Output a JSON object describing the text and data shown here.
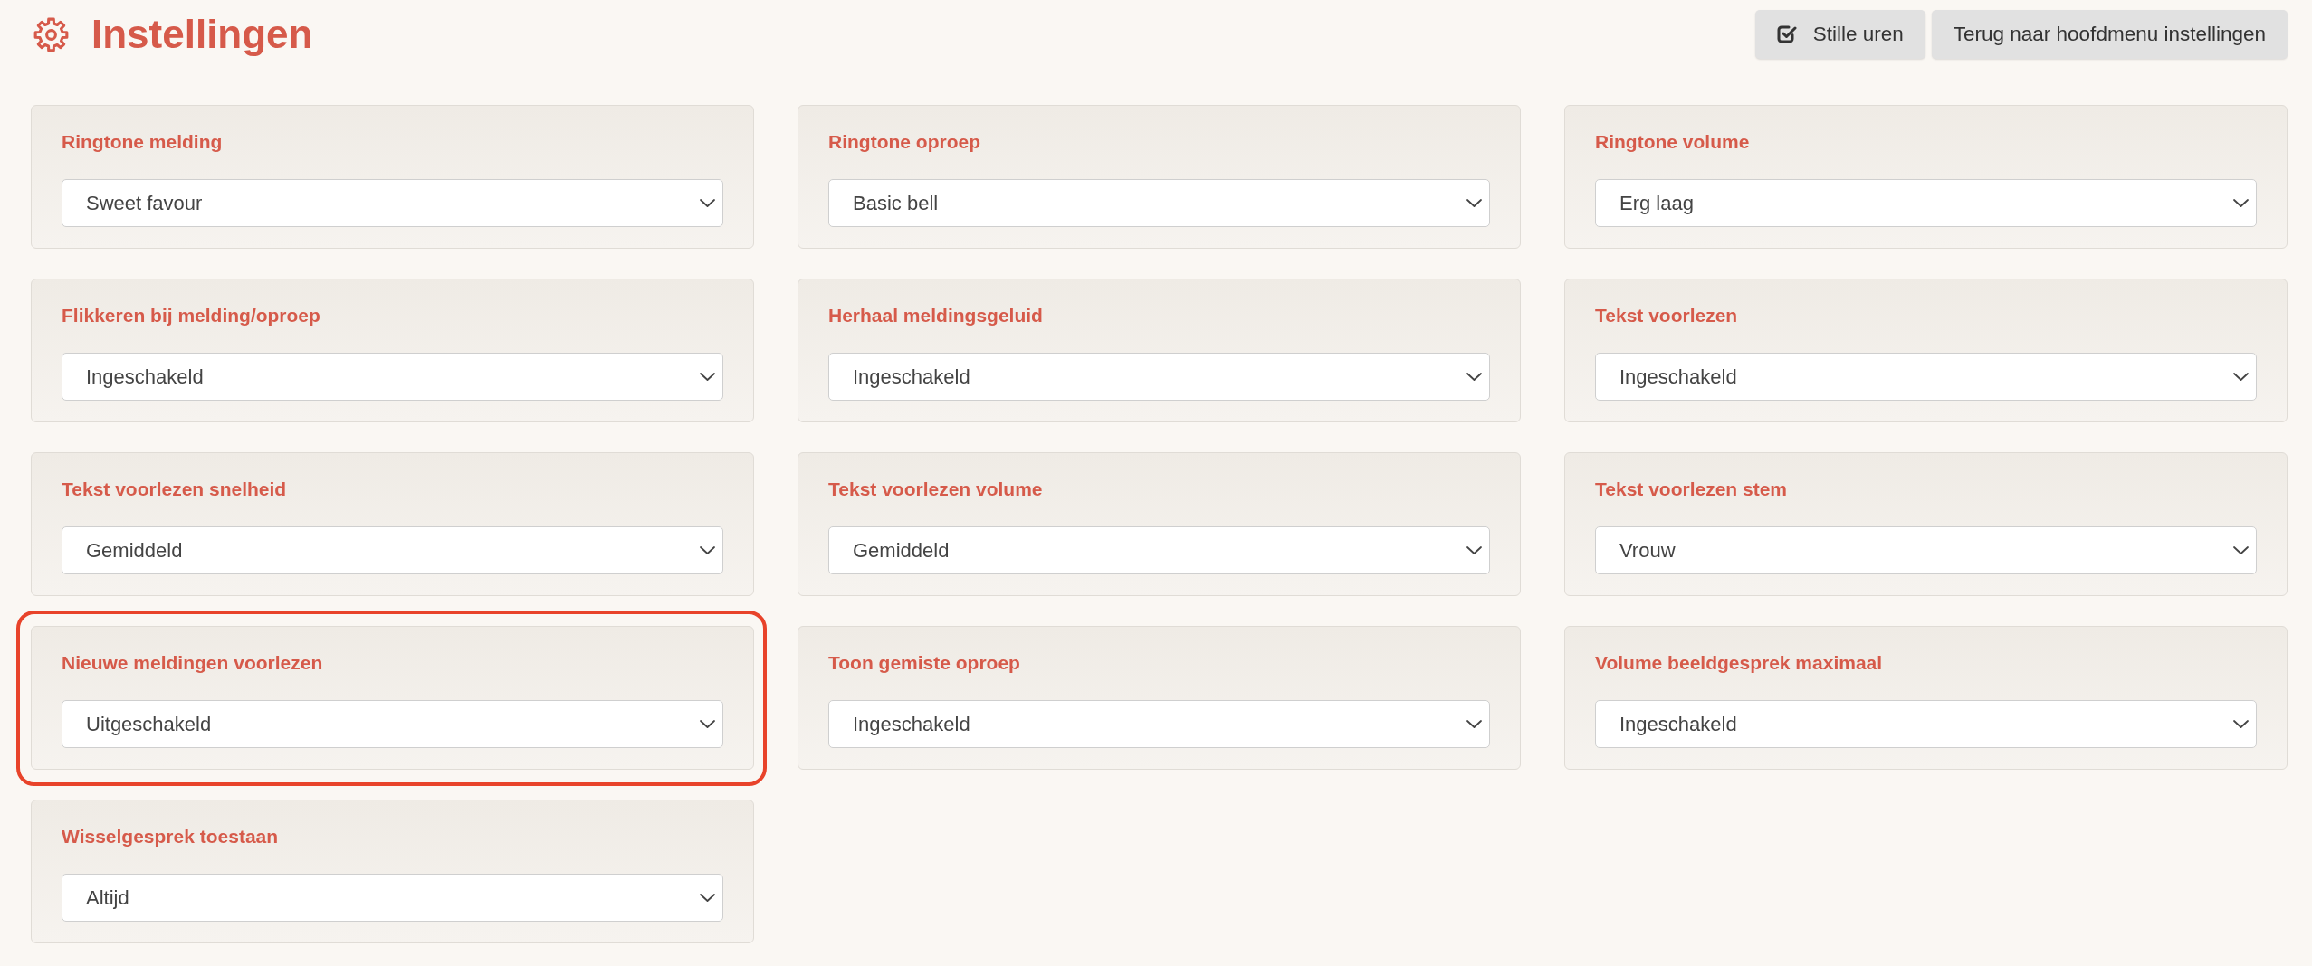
{
  "header": {
    "title": "Instellingen",
    "buttons": [
      {
        "label": "Stille uren",
        "kind": "icon"
      },
      {
        "label": "Terug naar hoofdmenu instellingen",
        "kind": "plain"
      }
    ]
  },
  "settings": [
    {
      "label": "Ringtone melding",
      "value": "Sweet favour",
      "highlighted": false
    },
    {
      "label": "Ringtone oproep",
      "value": "Basic bell",
      "highlighted": false
    },
    {
      "label": "Ringtone volume",
      "value": "Erg laag",
      "highlighted": false
    },
    {
      "label": "Flikkeren bij melding/oproep",
      "value": "Ingeschakeld",
      "highlighted": false
    },
    {
      "label": "Herhaal meldingsgeluid",
      "value": "Ingeschakeld",
      "highlighted": false
    },
    {
      "label": "Tekst voorlezen",
      "value": "Ingeschakeld",
      "highlighted": false
    },
    {
      "label": "Tekst voorlezen snelheid",
      "value": "Gemiddeld",
      "highlighted": false
    },
    {
      "label": "Tekst voorlezen volume",
      "value": "Gemiddeld",
      "highlighted": false
    },
    {
      "label": "Tekst voorlezen stem",
      "value": "Vrouw",
      "highlighted": false
    },
    {
      "label": "Nieuwe meldingen voorlezen",
      "value": "Uitgeschakeld",
      "highlighted": true
    },
    {
      "label": "Toon gemiste oproep",
      "value": "Ingeschakeld",
      "highlighted": false
    },
    {
      "label": "Volume beeldgesprek maximaal",
      "value": "Ingeschakeld",
      "highlighted": false
    },
    {
      "label": "Wisselgesprek toestaan",
      "value": "Altijd",
      "highlighted": false
    }
  ]
}
